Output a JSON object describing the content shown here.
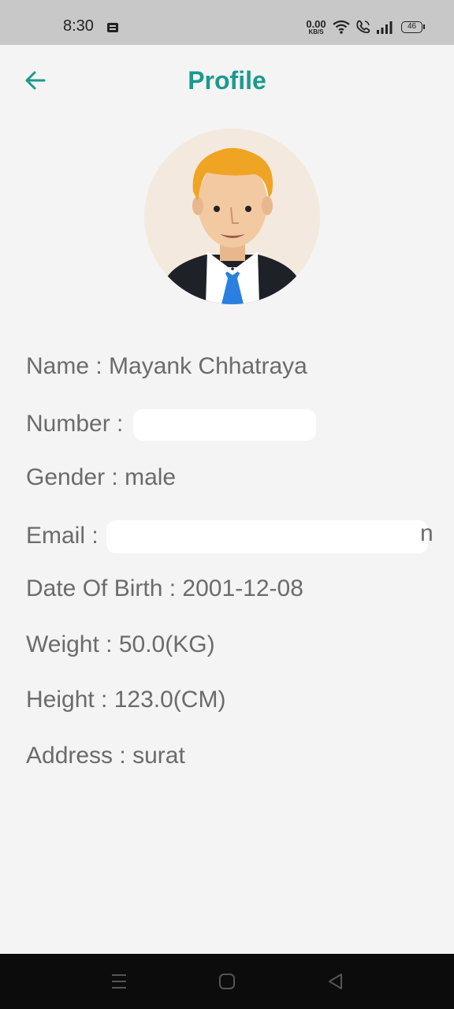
{
  "status_bar": {
    "time": "8:30",
    "net_speed_value": "0.00",
    "net_speed_unit": "KB/S",
    "battery": "46",
    "icons": [
      "message-icon",
      "wifi-icon",
      "call-icon",
      "signal-icon",
      "battery-icon"
    ]
  },
  "header": {
    "title": "Profile",
    "back_icon": "arrow-left-icon",
    "accent_color": "#1b9a8e"
  },
  "avatar": {
    "icon": "person-avatar-icon"
  },
  "profile": {
    "name_label": "Name :",
    "name_value": "Mayank Chhatraya",
    "number_label": "Number :",
    "gender_label": "Gender :",
    "gender_value": "male",
    "email_label": "Email :",
    "email_trailing": "n",
    "dob_label": "Date Of Birth :",
    "dob_value": "2001-12-08",
    "weight_label": "Weight :",
    "weight_value": "50.0(KG)",
    "height_label": "Height :",
    "height_value": "123.0(CM)",
    "address_label": "Address :",
    "address_value": "surat"
  },
  "nav_bar": {
    "icons": [
      "menu-icon",
      "home-icon",
      "back-triangle-icon"
    ]
  }
}
